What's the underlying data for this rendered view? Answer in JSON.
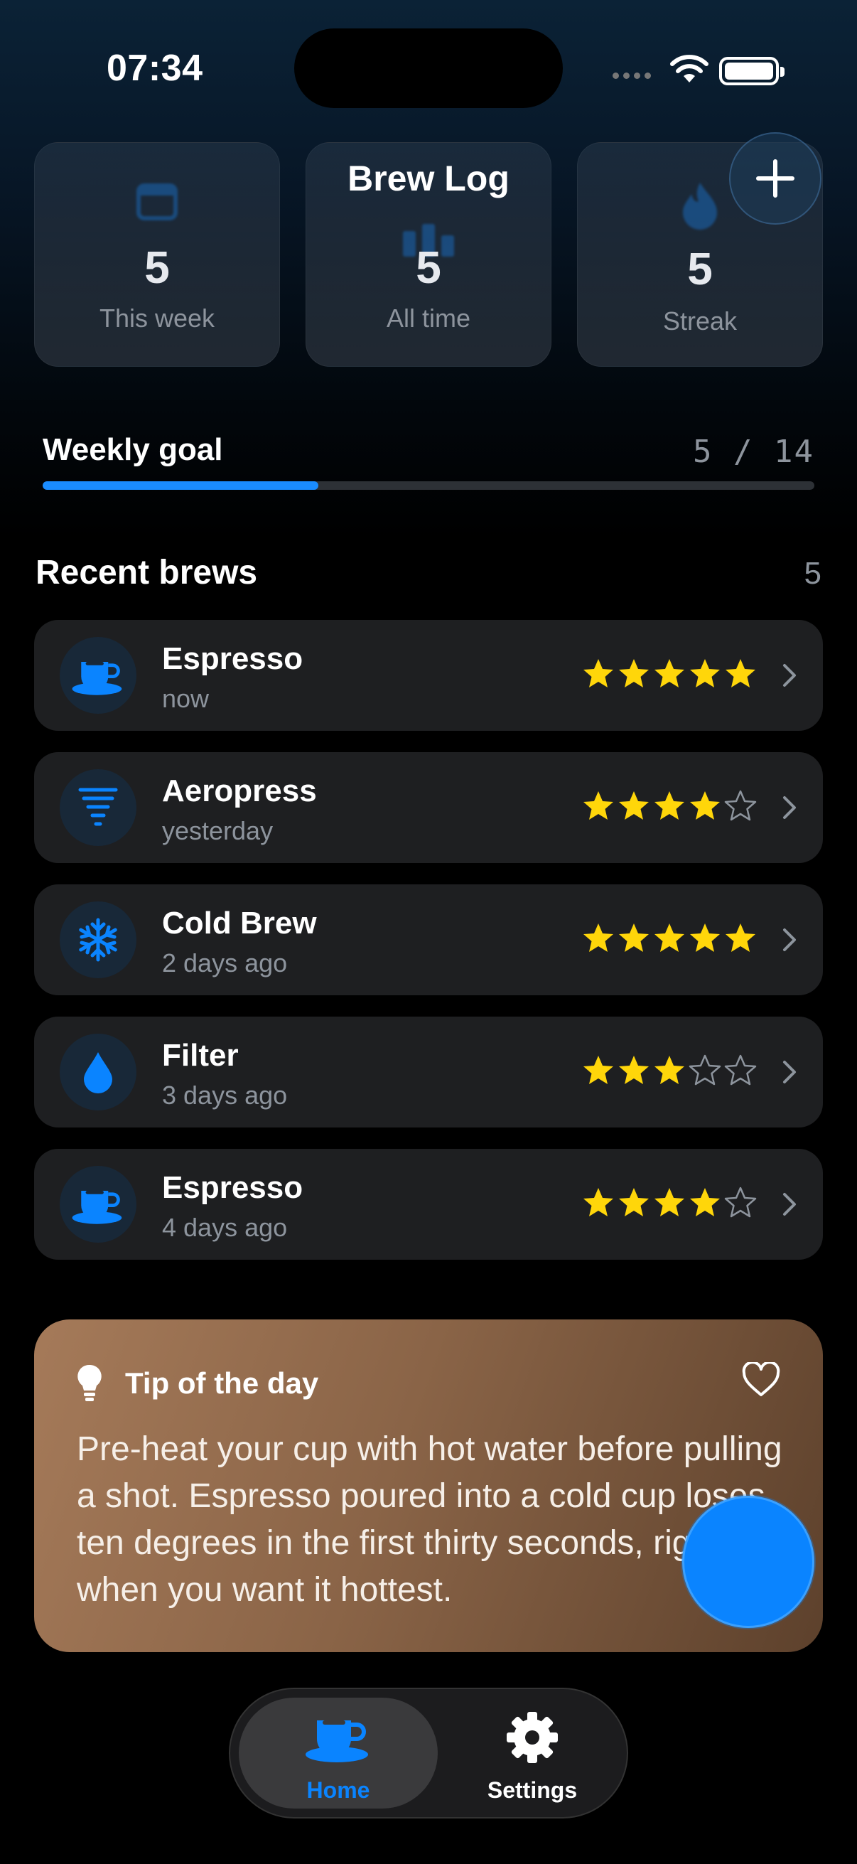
{
  "status": {
    "time": "07:34"
  },
  "header": {
    "title": "Brew Log",
    "add_icon": "plus-icon"
  },
  "stats": [
    {
      "icon": "calendar-icon",
      "value": "5",
      "label": "This week"
    },
    {
      "icon": "bar-chart-icon",
      "value": "5",
      "label": "All time"
    },
    {
      "icon": "flame-icon",
      "value": "5",
      "label": "Streak"
    }
  ],
  "goal": {
    "label": "Weekly goal",
    "current": 5,
    "target": 14,
    "count_text": "5 / 14",
    "progress": 0.357
  },
  "recent": {
    "title": "Recent brews",
    "count": "5",
    "items": [
      {
        "name": "Espresso",
        "time": "now",
        "rating": 5,
        "icon": "coffee-cup-icon"
      },
      {
        "name": "Aeropress",
        "time": "yesterday",
        "rating": 4,
        "icon": "tornado-icon"
      },
      {
        "name": "Cold Brew",
        "time": "2 days ago",
        "rating": 5,
        "icon": "snowflake-icon"
      },
      {
        "name": "Filter",
        "time": "3 days ago",
        "rating": 3,
        "icon": "water-drop-icon"
      },
      {
        "name": "Espresso",
        "time": "4 days ago",
        "rating": 4,
        "icon": "coffee-cup-icon"
      }
    ]
  },
  "tip": {
    "title": "Tip of the day",
    "text": "Pre-heat your cup with hot water before pulling a shot. Espresso poured into a cold cup loses ten degrees in the first thirty seconds, right when you want it hottest."
  },
  "tabs": [
    {
      "label": "Home",
      "icon": "coffee-cup-icon",
      "active": true
    },
    {
      "label": "Settings",
      "icon": "gear-icon",
      "active": false
    }
  ],
  "colors": {
    "accent": "#0a84ff",
    "star": "#ffd60a",
    "card": "#1e1f21",
    "tip_from": "#a57a59",
    "tip_to": "#5d412c"
  }
}
